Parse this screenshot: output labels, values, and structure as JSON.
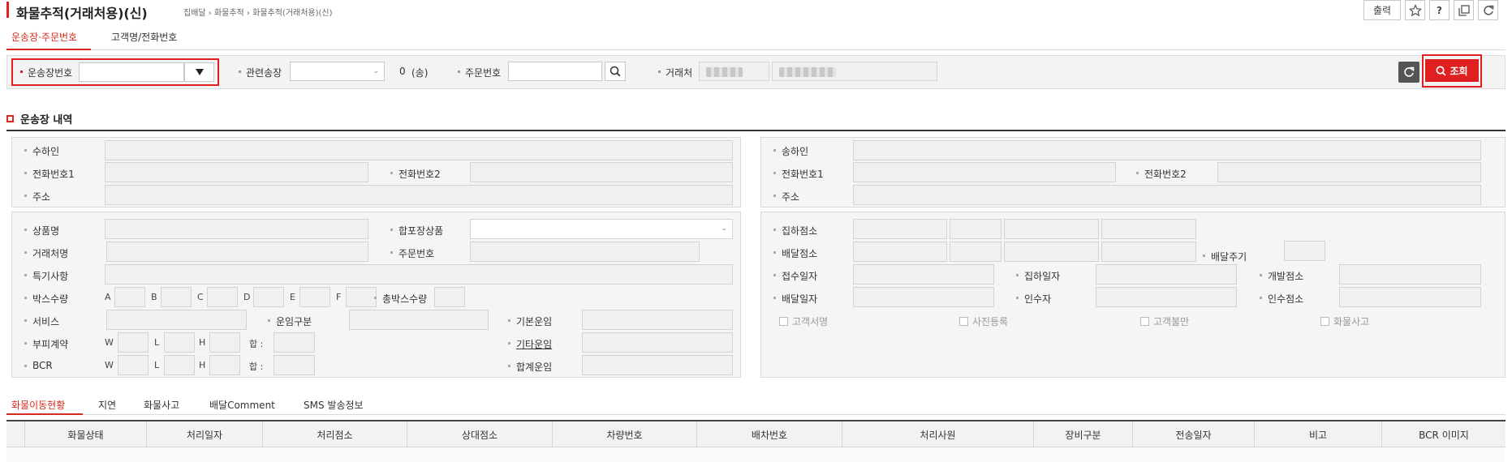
{
  "header": {
    "title": "화물추적(거래처용)(신)",
    "breadcrumb": "집배달 › 화물추적 › 화물추적(거래처용)(신)",
    "print_label": "출력"
  },
  "tabs": [
    "운송장·주문번호",
    "고객명/전화번호"
  ],
  "search": {
    "waybill_label": "운송장번호",
    "waybill_value": "",
    "related_label": "관련송장",
    "related_count": "0",
    "related_unit": "(송)",
    "order_label": "주문번호",
    "order_value": "",
    "client_label": "거래처",
    "submit_label": "조회"
  },
  "section": {
    "title": "운송장 내역"
  },
  "receiver": {
    "name_label": "수하인",
    "phone1_label": "전화번호1",
    "phone2_label": "전화번호2",
    "address_label": "주소"
  },
  "sender": {
    "name_label": "송하인",
    "phone1_label": "전화번호1",
    "phone2_label": "전화번호2",
    "address_label": "주소"
  },
  "goods": {
    "product_label": "상품명",
    "combined_label": "합포장상품",
    "client_label": "거래처명",
    "order_label": "주문번호",
    "special_label": "특기사항",
    "box_label": "박스수량",
    "box_sizes": [
      "A",
      "B",
      "C",
      "D",
      "E",
      "F"
    ],
    "total_box_label": "총박스수량",
    "service_label": "서비스",
    "fare_type_label": "운임구분",
    "base_fare_label": "기본운임",
    "volume_label": "부피계약",
    "other_fare_label": "기타운임",
    "bcr_label": "BCR",
    "total_fare_label": "합계운임",
    "w": "W",
    "l": "L",
    "h": "H",
    "sum": "합 :"
  },
  "delivery": {
    "pickup_branch_label": "집하점소",
    "delivery_branch_label": "배달점소",
    "cycle_label": "배달주기",
    "accept_date_label": "접수일자",
    "pickup_date_label": "집하일자",
    "dev_branch_label": "개발점소",
    "delivery_date_label": "배달일자",
    "receiver_label": "인수자",
    "receive_branch_label": "인수점소",
    "checks": [
      "고객서명",
      "사진등록",
      "고객불만",
      "화물사고"
    ]
  },
  "bottom_tabs": [
    "화물이동현황",
    "지연",
    "화물사고",
    "배달Comment",
    "SMS 발송정보"
  ],
  "grid": {
    "columns": [
      "화물상태",
      "처리일자",
      "처리점소",
      "상대점소",
      "차량번호",
      "배차번호",
      "처리사원",
      "장비구분",
      "전송일자",
      "비고",
      "BCR 이미지"
    ]
  }
}
